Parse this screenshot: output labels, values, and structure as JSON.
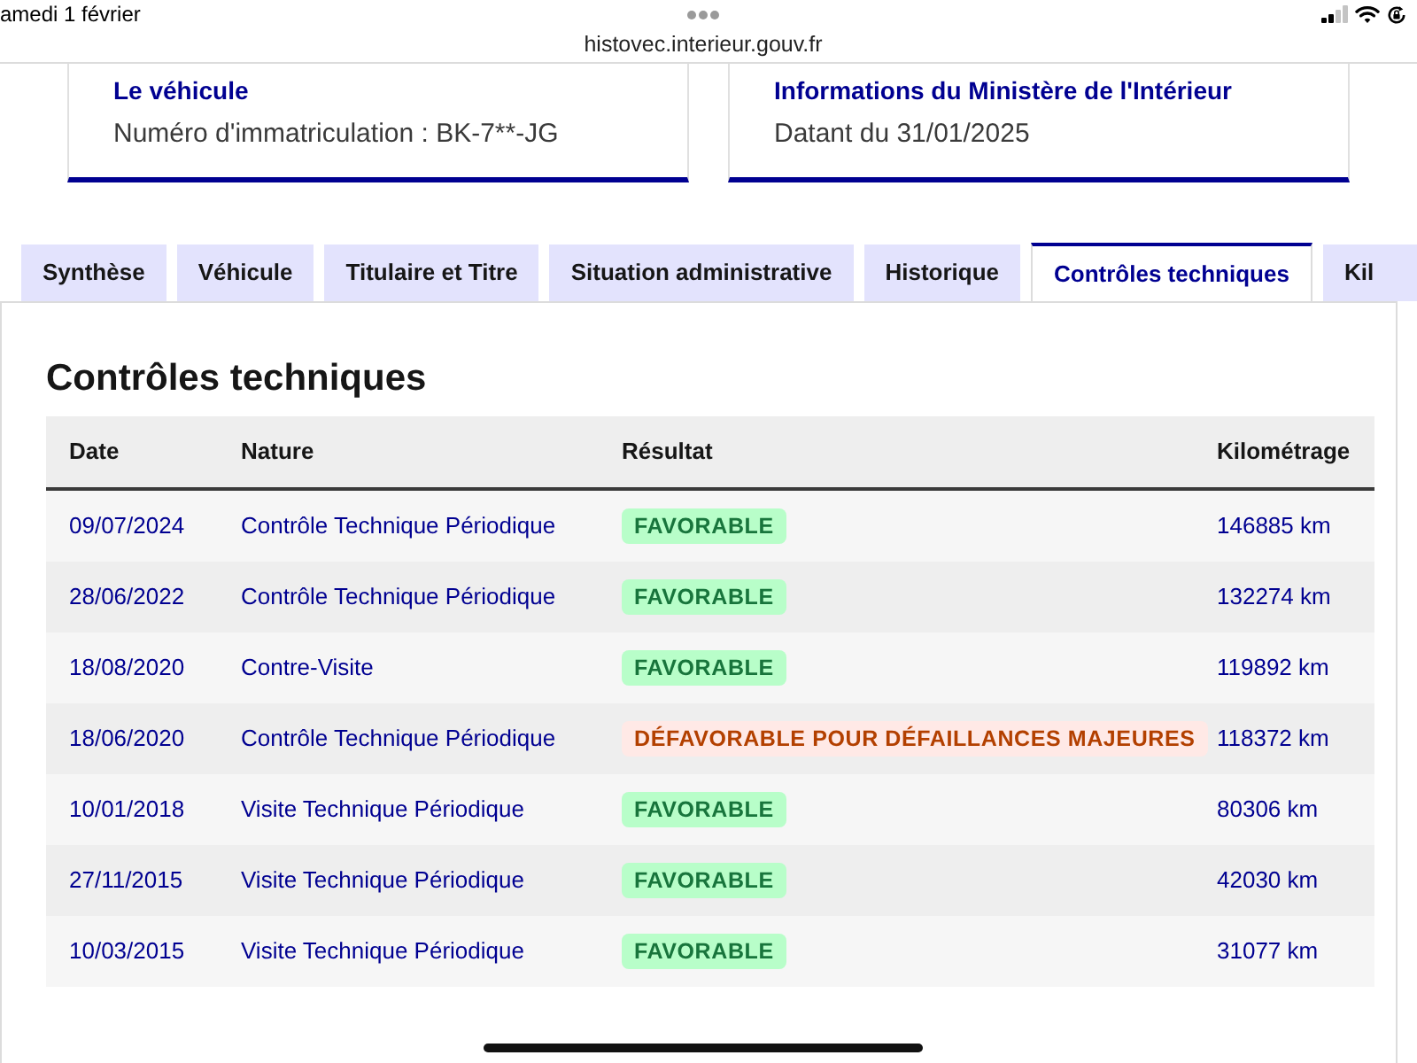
{
  "status_bar": {
    "date": "amedi 1 février",
    "url": "histovec.interieur.gouv.fr"
  },
  "cards": [
    {
      "title": "Le véhicule",
      "text": "Numéro d'immatriculation : BK-7**-JG"
    },
    {
      "title": "Informations du Ministère de l'Intérieur",
      "text": "Datant du 31/01/2025"
    }
  ],
  "tabs": [
    {
      "label": "Synthèse",
      "selected": false
    },
    {
      "label": "Véhicule",
      "selected": false
    },
    {
      "label": "Titulaire et Titre",
      "selected": false
    },
    {
      "label": "Situation administrative",
      "selected": false
    },
    {
      "label": "Historique",
      "selected": false
    },
    {
      "label": "Contrôles techniques",
      "selected": true
    },
    {
      "label": "Kil",
      "selected": false
    }
  ],
  "section": {
    "title": "Contrôles techniques",
    "table": {
      "columns": [
        "Date",
        "Nature",
        "Résultat",
        "Kilométrage"
      ],
      "rows": [
        {
          "date": "09/07/2024",
          "nature": "Contrôle Technique Périodique",
          "result": {
            "text": "FAVORABLE",
            "kind": "favorable"
          },
          "mileage": "146885 km"
        },
        {
          "date": "28/06/2022",
          "nature": "Contrôle Technique Périodique",
          "result": {
            "text": "FAVORABLE",
            "kind": "favorable"
          },
          "mileage": "132274 km"
        },
        {
          "date": "18/08/2020",
          "nature": "Contre-Visite",
          "result": {
            "text": "FAVORABLE",
            "kind": "favorable"
          },
          "mileage": "119892 km"
        },
        {
          "date": "18/06/2020",
          "nature": "Contrôle Technique Périodique",
          "result": {
            "text": "DÉFAVORABLE POUR DÉFAILLANCES MAJEURES",
            "kind": "unfavorable"
          },
          "mileage": "118372 km"
        },
        {
          "date": "10/01/2018",
          "nature": "Visite Technique Périodique",
          "result": {
            "text": "FAVORABLE",
            "kind": "favorable"
          },
          "mileage": "80306 km"
        },
        {
          "date": "27/11/2015",
          "nature": "Visite Technique Périodique",
          "result": {
            "text": "FAVORABLE",
            "kind": "favorable"
          },
          "mileage": "42030 km"
        },
        {
          "date": "10/03/2015",
          "nature": "Visite Technique Périodique",
          "result": {
            "text": "FAVORABLE",
            "kind": "favorable"
          },
          "mileage": "31077 km"
        }
      ]
    }
  }
}
